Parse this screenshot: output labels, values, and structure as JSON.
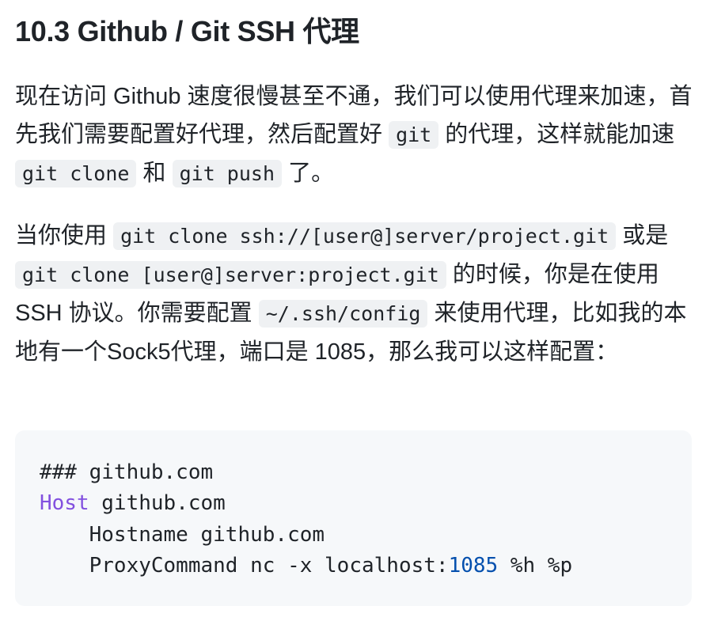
{
  "heading": "10.3 Github / Git SSH 代理",
  "paragraph1": {
    "text_a": "现在访问 Github 速度很慢甚至不通，我们可以使用代理来加速，首先我们需要配置好代理，然后配置好 ",
    "code_git": "git",
    "text_b": " 的代理，这样就能加速 ",
    "code_git_clone": "git clone",
    "text_c": " 和 ",
    "code_git_push": "git push",
    "text_d": " 了。"
  },
  "paragraph2": {
    "text_a": "当你使用 ",
    "code_clone_ssh": "git clone ssh://[user@]server/project.git",
    "text_b": " 或是 ",
    "code_clone_scp": "git clone [user@]server:project.git",
    "text_c": " 的时候，你是在使用 SSH 协议。你需要配置 ",
    "code_ssh_config": "~/.ssh/config",
    "text_d": " 来使用代理，比如我的本地有一个Sock5代理，端口是 1085，那么我可以这样配置："
  },
  "code_block": {
    "line1_comment": "### github.com",
    "line2_keyword": "Host",
    "line2_rest": " github.com",
    "line3": "    Hostname github.com",
    "line4_prefix": "    ProxyCommand nc -x localhost:",
    "line4_port": "1085",
    "line4_suffix": " %h %p"
  },
  "colors": {
    "text": "#1f2328",
    "inline_code_bg": "#eff1f3",
    "code_block_bg": "#f6f8fa",
    "keyword": "#8250df",
    "number": "#0550ae"
  }
}
